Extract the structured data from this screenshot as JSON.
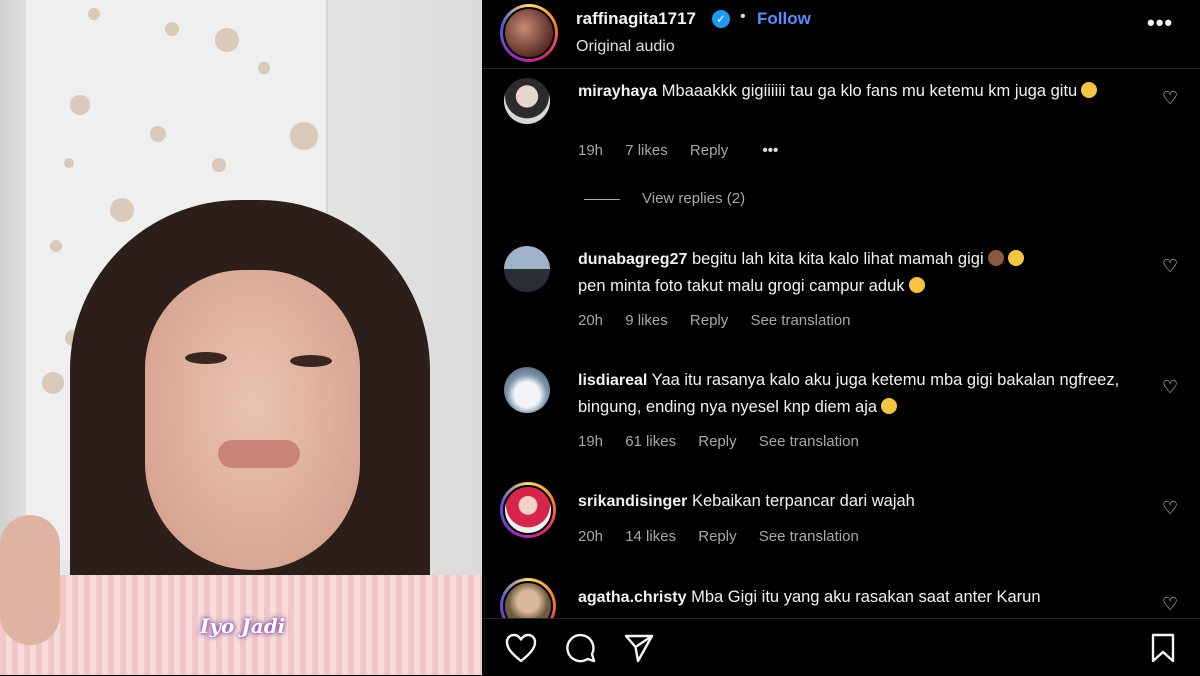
{
  "media": {
    "caption": "Iyo Jadi"
  },
  "post": {
    "username": "raffinagita1717",
    "follow_label": "Follow",
    "audio": "Original audio",
    "more_icon": "more-horizontal-icon"
  },
  "comments": [
    {
      "username": "mirayhaya",
      "text": "Mbaaakkk gigiiiiii tau ga klo fans mu ketemu km juga gitu",
      "time": "19h",
      "likes": "7 likes",
      "reply": "Reply",
      "extra": "•••",
      "view_replies": "View replies (2)"
    },
    {
      "username": "dunabagreg27",
      "text": "begitu lah kita kita kalo lihat mamah gigi",
      "text2": "pen minta foto takut malu grogi campur aduk",
      "time": "20h",
      "likes": "9 likes",
      "reply": "Reply",
      "translate": "See translation"
    },
    {
      "username": "lisdiareal",
      "text": "Yaa itu rasanya kalo aku juga ketemu mba gigi bakalan ngfreez, bingung, ending nya nyesel knp diem aja",
      "time": "19h",
      "likes": "61 likes",
      "reply": "Reply",
      "translate": "See translation"
    },
    {
      "username": "srikandisinger",
      "text": "Kebaikan terpancar dari wajah",
      "time": "20h",
      "likes": "14 likes",
      "reply": "Reply",
      "translate": "See translation"
    },
    {
      "username": "agatha.christy",
      "text": "Mba Gigi itu yang aku rasakan saat anter Karun"
    }
  ],
  "colors": {
    "accent": "#5b8cff",
    "verified": "#1d9bf0",
    "muted": "#a8a8a8"
  }
}
